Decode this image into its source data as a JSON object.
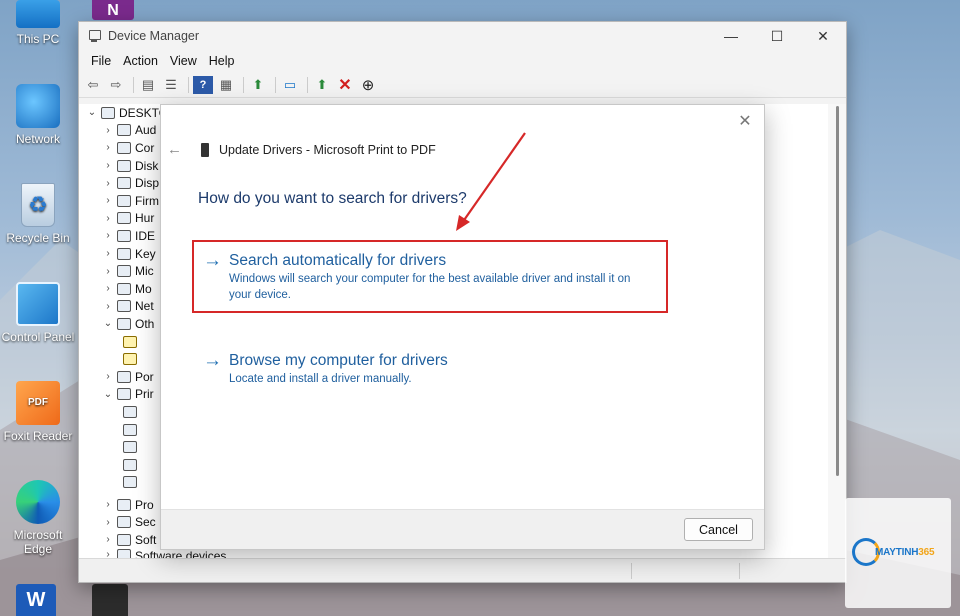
{
  "desktop_icons": [
    {
      "label": "This PC"
    },
    {
      "label": "Network"
    },
    {
      "label": "Recycle Bin"
    },
    {
      "label": "Control Panel"
    },
    {
      "label": "Foxit Reader"
    },
    {
      "label": "Microsoft Edge"
    }
  ],
  "device_manager": {
    "title": "Device Manager",
    "menu": [
      "File",
      "Action",
      "View",
      "Help"
    ],
    "tree": [
      {
        "label": "DESKTO",
        "chev": "⌄"
      },
      {
        "label": "Aud",
        "chev": "›"
      },
      {
        "label": "Cor",
        "chev": "›"
      },
      {
        "label": "Disk",
        "chev": "›"
      },
      {
        "label": "Disp",
        "chev": "›"
      },
      {
        "label": "Firm",
        "chev": "›"
      },
      {
        "label": "Hur",
        "chev": "›"
      },
      {
        "label": "IDE",
        "chev": "›"
      },
      {
        "label": "Key",
        "chev": "›"
      },
      {
        "label": "Mic",
        "chev": "›"
      },
      {
        "label": "Mo",
        "chev": "›"
      },
      {
        "label": "Net",
        "chev": "›"
      },
      {
        "label": "Oth",
        "chev": "⌄"
      },
      {
        "label": "",
        "chev": ""
      },
      {
        "label": "",
        "chev": ""
      },
      {
        "label": "Por",
        "chev": "›"
      },
      {
        "label": "Prir",
        "chev": "⌄"
      },
      {
        "label": "",
        "chev": ""
      },
      {
        "label": "",
        "chev": ""
      },
      {
        "label": "",
        "chev": ""
      },
      {
        "label": "",
        "chev": ""
      },
      {
        "label": "",
        "chev": ""
      },
      {
        "label": "Pro",
        "chev": "›"
      },
      {
        "label": "Sec",
        "chev": "›"
      },
      {
        "label": "Soft",
        "chev": "›"
      },
      {
        "label": "Software devices",
        "chev": "›"
      }
    ]
  },
  "dialog": {
    "title": "Update Drivers - Microsoft Print to PDF",
    "question": "How do you want to search for drivers?",
    "option_auto": {
      "title": "Search automatically for drivers",
      "desc": "Windows will search your computer for the best available driver and install it on your device."
    },
    "option_browse": {
      "title": "Browse my computer for drivers",
      "desc": "Locate and install a driver manually."
    },
    "cancel_label": "Cancel"
  },
  "watermark": {
    "brand": "MAYTINH",
    "brand_num": "365"
  },
  "colors": {
    "highlight": "#d62828",
    "link": "#1f5f9e",
    "arrow": "#d62828"
  }
}
